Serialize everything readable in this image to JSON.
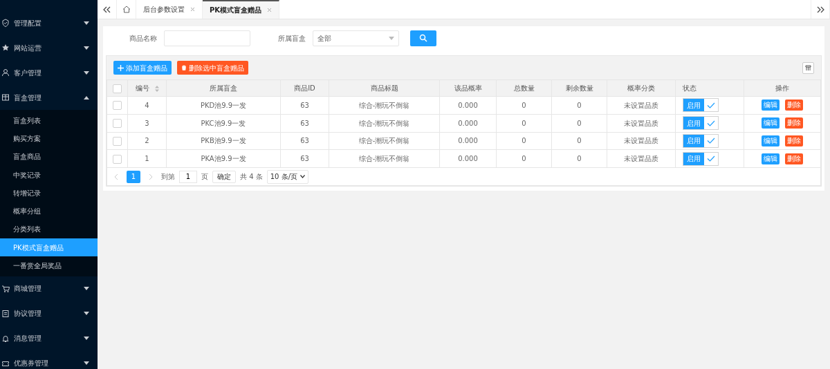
{
  "sidebar": {
    "items": [
      {
        "label": "管理配置",
        "expanded": false
      },
      {
        "label": "网站运营",
        "expanded": false
      },
      {
        "label": "客户管理",
        "expanded": false
      },
      {
        "label": "盲盒管理",
        "expanded": true,
        "children": [
          {
            "label": "盲盒列表",
            "selected": false
          },
          {
            "label": "购买方案",
            "selected": false
          },
          {
            "label": "盲盒商品",
            "selected": false
          },
          {
            "label": "中奖记录",
            "selected": false
          },
          {
            "label": "转增记录",
            "selected": false
          },
          {
            "label": "概率分组",
            "selected": false
          },
          {
            "label": "分类列表",
            "selected": false
          },
          {
            "label": "PK模式盲盒赠品",
            "selected": true
          },
          {
            "label": "一番赏全局奖品",
            "selected": false
          }
        ]
      },
      {
        "label": "商城管理",
        "expanded": false
      },
      {
        "label": "协议管理",
        "expanded": false
      },
      {
        "label": "消息管理",
        "expanded": false
      },
      {
        "label": "优惠券管理",
        "expanded": false
      }
    ]
  },
  "tabs": [
    {
      "label": "后台参数设置",
      "selected": false
    },
    {
      "label": "PK模式盲盒赠品",
      "selected": true
    }
  ],
  "filters": {
    "name_label": "商品名称",
    "box_label": "所属盲盒",
    "box_value": "全部"
  },
  "toolbar": {
    "add": "添加盲盒赠品",
    "delete": "删除选中盲盒赠品"
  },
  "table": {
    "all_checked": false,
    "columns": [
      "编号",
      "所属盲盒",
      "商品ID",
      "商品标题",
      "该品概率",
      "总数量",
      "剩余数量",
      "概率分类",
      "状态",
      "操作"
    ],
    "rows": [
      {
        "checked": false,
        "cells": [
          "4",
          "PKD池9.9一发",
          "63",
          "综合-潮玩不倒翁",
          "0.000",
          "0",
          "0",
          "未设置品质"
        ],
        "status": "启用",
        "on": true,
        "edit": "编辑",
        "del": "删除"
      },
      {
        "checked": false,
        "cells": [
          "3",
          "PKC池9.9一发",
          "63",
          "综合-潮玩不倒翁",
          "0.000",
          "0",
          "0",
          "未设置品质"
        ],
        "status": "启用",
        "on": true,
        "edit": "编辑",
        "del": "删除"
      },
      {
        "checked": false,
        "cells": [
          "2",
          "PKB池9.9一发",
          "63",
          "综合-潮玩不倒翁",
          "0.000",
          "0",
          "0",
          "未设置品质"
        ],
        "status": "启用",
        "on": true,
        "edit": "编辑",
        "del": "删除"
      },
      {
        "checked": false,
        "cells": [
          "1",
          "PKA池9.9一发",
          "63",
          "综合-潮玩不倒翁",
          "0.000",
          "0",
          "0",
          "未设置品质"
        ],
        "status": "启用",
        "on": true,
        "edit": "编辑",
        "del": "删除"
      }
    ]
  },
  "pagination": {
    "pages": [
      {
        "label": "1",
        "selected": true
      }
    ],
    "goto": "到第",
    "page_value": "1",
    "page_unit": "页",
    "confirm": "确定",
    "total": "共 4 条",
    "page_size": "10 条/页"
  }
}
